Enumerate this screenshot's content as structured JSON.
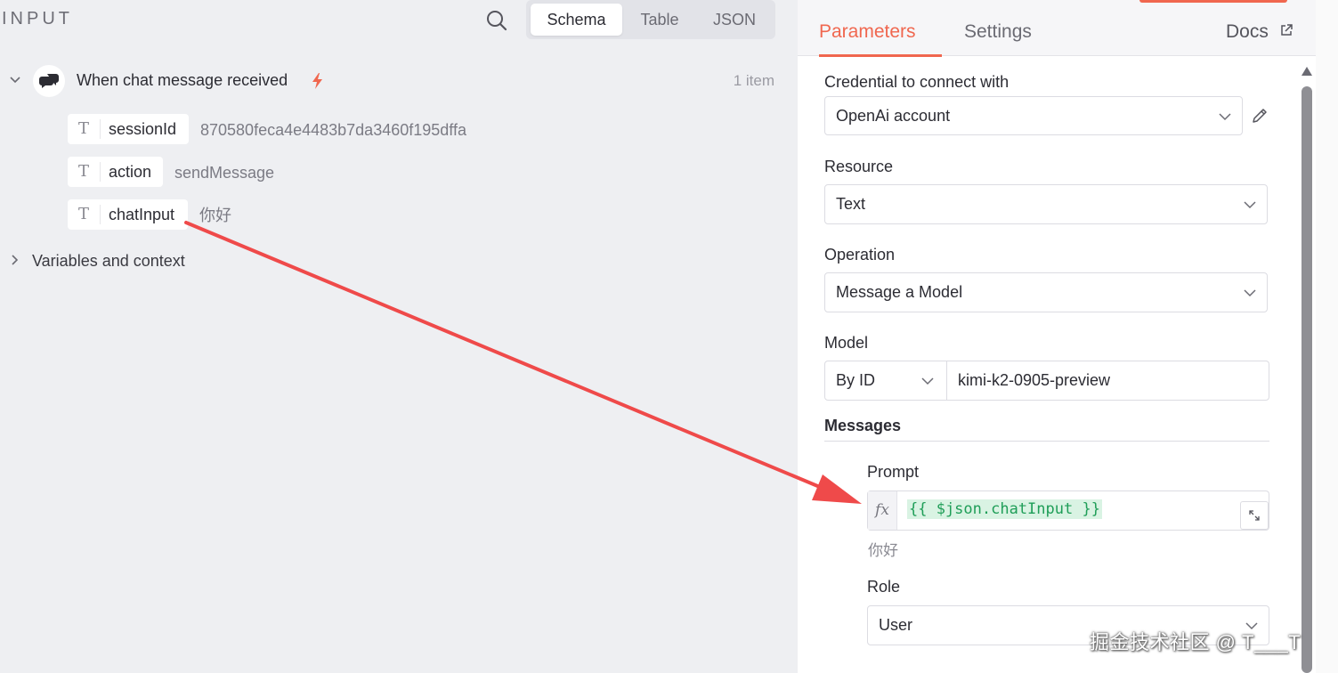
{
  "input_panel": {
    "title": "INPUT",
    "view_tabs": [
      "Schema",
      "Table",
      "JSON"
    ],
    "active_view": "Schema",
    "node": {
      "name": "When chat message received",
      "item_count": "1 item",
      "fields": [
        {
          "key": "sessionId",
          "value": "870580feca4e4483b7da3460f195dffa"
        },
        {
          "key": "action",
          "value": "sendMessage"
        },
        {
          "key": "chatInput",
          "value": "你好"
        }
      ]
    },
    "variables_label": "Variables and context"
  },
  "params_panel": {
    "tabs": [
      "Parameters",
      "Settings"
    ],
    "active_tab": "Parameters",
    "docs_label": "Docs",
    "credential": {
      "label": "Credential to connect with",
      "value": "OpenAi account"
    },
    "resource": {
      "label": "Resource",
      "value": "Text"
    },
    "operation": {
      "label": "Operation",
      "value": "Message a Model"
    },
    "model": {
      "label": "Model",
      "mode": "By ID",
      "value": "kimi-k2-0905-preview"
    },
    "messages": {
      "title": "Messages",
      "prompt_label": "Prompt",
      "prompt_expression": "{{ $json.chatInput }}",
      "prompt_preview": "你好",
      "role_label": "Role",
      "role_value": "User"
    }
  },
  "watermark": "掘金技术社区 @ T___T",
  "colors": {
    "accent": "#f0674f",
    "expression_green": "#1f9e58",
    "annotation_arrow": "#ef4a4a"
  }
}
